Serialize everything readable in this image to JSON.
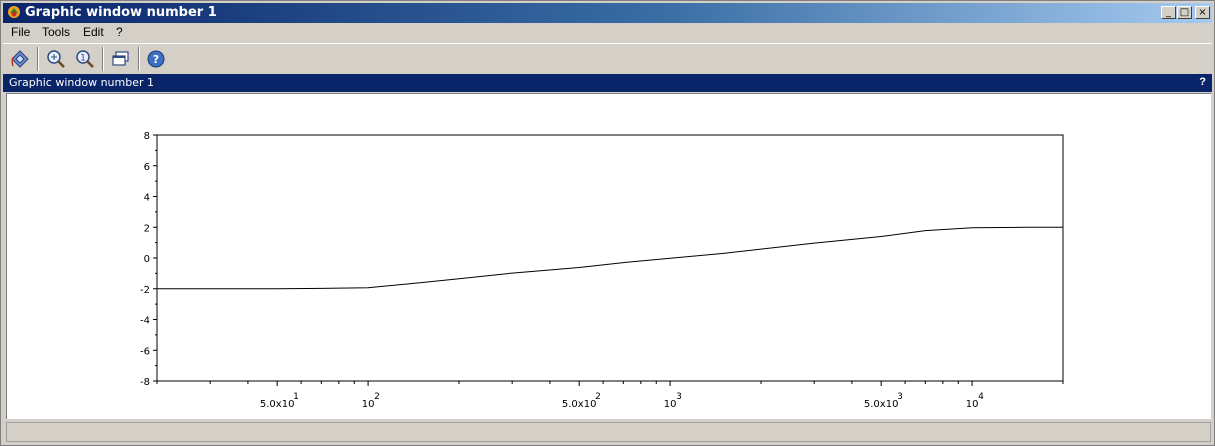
{
  "window": {
    "title": "Graphic window number 1",
    "controls": {
      "minimize": "_",
      "maximize": "□",
      "close": "×"
    }
  },
  "menu": {
    "items": [
      "File",
      "Tools",
      "Edit",
      "?"
    ]
  },
  "toolbar": {
    "buttons": [
      "rotate-2d-3d-icon",
      "zoom-icon",
      "unzoom-icon",
      "new-window-icon",
      "help-icon"
    ]
  },
  "dock": {
    "title": "Graphic window number 1",
    "help": "?"
  },
  "status": {
    "text": ""
  },
  "chart_data": {
    "type": "line",
    "xscale": "log",
    "xlim": [
      20,
      20000
    ],
    "ylim": [
      -8,
      8
    ],
    "yticks": [
      -8,
      -6,
      -4,
      -2,
      0,
      2,
      4,
      6,
      8
    ],
    "ytick_labels": [
      "-8",
      "-6",
      "-4",
      "-2",
      "0",
      "2",
      "4",
      "6",
      "8"
    ],
    "xtick_labels": [
      {
        "value": 50,
        "mantissa": "5.0x10",
        "exponent": "1"
      },
      {
        "value": 100,
        "mantissa": "10",
        "exponent": "2"
      },
      {
        "value": 500,
        "mantissa": "5.0x10",
        "exponent": "2"
      },
      {
        "value": 1000,
        "mantissa": "10",
        "exponent": "3"
      },
      {
        "value": 5000,
        "mantissa": "5.0x10",
        "exponent": "3"
      },
      {
        "value": 10000,
        "mantissa": "10",
        "exponent": "4"
      }
    ],
    "series": [
      {
        "color": "#000000",
        "x": [
          20,
          30,
          50,
          70,
          100,
          150,
          200,
          300,
          500,
          700,
          1000,
          1500,
          2000,
          3000,
          5000,
          7000,
          10000,
          15000,
          20000
        ],
        "y": [
          -2,
          -2,
          -2,
          -1.98,
          -1.93,
          -1.6,
          -1.35,
          -0.98,
          -0.62,
          -0.3,
          -0.02,
          0.3,
          0.58,
          0.97,
          1.4,
          1.78,
          1.97,
          2,
          2
        ]
      }
    ]
  }
}
